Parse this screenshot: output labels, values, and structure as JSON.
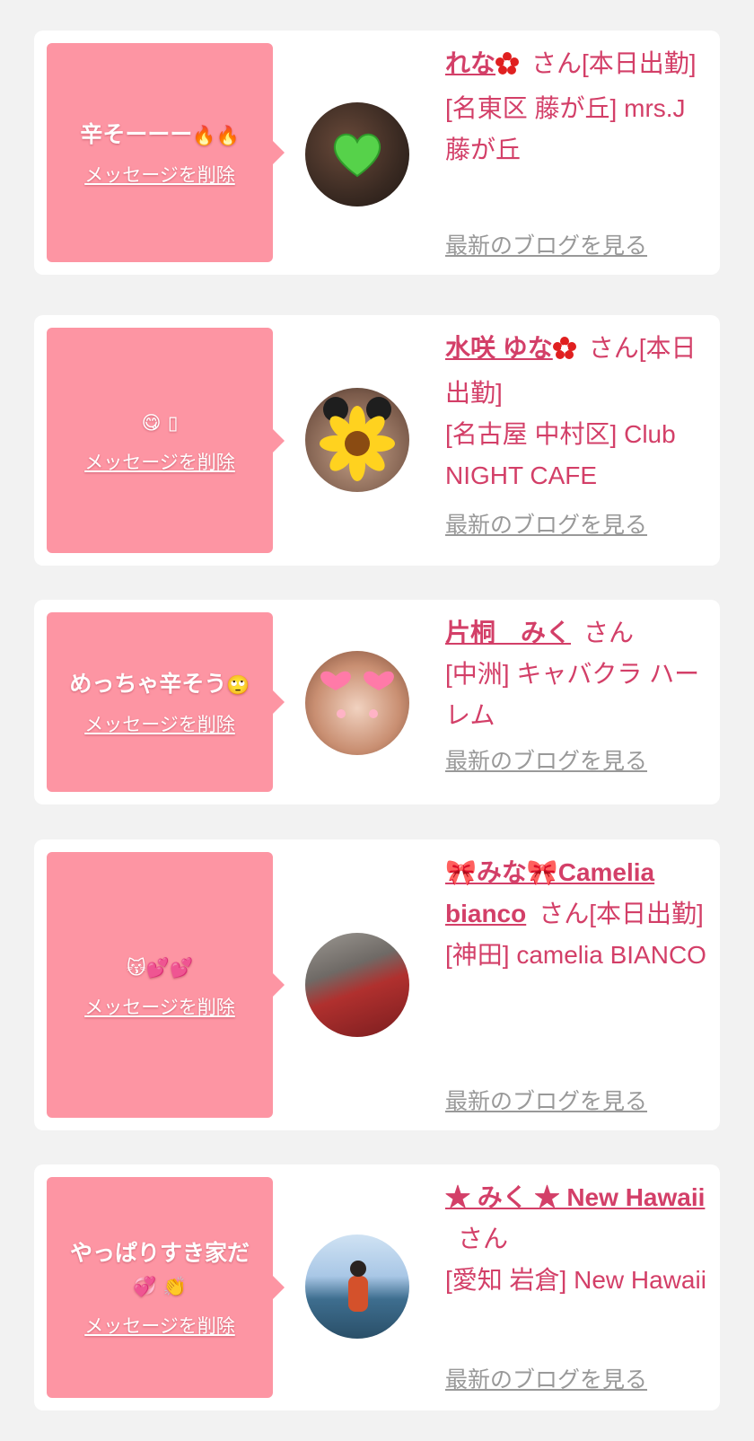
{
  "delete_label": "メッセージを削除",
  "blog_label": "最新のブログを見る",
  "colors": {
    "bubble": "#fd95a3",
    "accent": "#d33f68",
    "muted": "#999999",
    "page_bg": "#f2f2f2"
  },
  "messages": [
    {
      "text": "辛そーーー",
      "emoji": "🔥🔥",
      "name": "れな",
      "name_icon": "red-flower-icon",
      "suffix": "さん[本日出勤]",
      "location": "[名東区 藤が丘] mrs.J藤が丘",
      "avatar_icon": "green-heart-sticker-icon"
    },
    {
      "text": "",
      "emoji": "😋 ▯",
      "name": "水咲 ゆな",
      "name_icon": "red-flower-icon",
      "suffix": "さん[本日出勤]",
      "location": "[名古屋 中村区] Club NIGHT CAFE",
      "avatar_icon": "sunflower-sticker-icon"
    },
    {
      "text": "めっちゃ辛そう",
      "emoji": "🙄",
      "name": "片桐　みく",
      "name_icon": "",
      "suffix": "さん",
      "location": "[中洲] キャバクラ ハーレム",
      "avatar_icon": "heart-ears-filter-icon"
    },
    {
      "text": "",
      "emoji": "😽💕💕",
      "name": "🎀みな🎀Camelia bianco",
      "name_icon": "",
      "suffix": "さん[本日出勤]",
      "location": "[神田] camelia BIANCO",
      "avatar_icon": "photo-icon"
    },
    {
      "text": "やっぱりすき家だ",
      "emoji": "💞 👏",
      "name": "★ みく ★ New Hawaii",
      "name_icon": "",
      "suffix": "さん",
      "location": "[愛知 岩倉] New Hawaii",
      "avatar_icon": "photo-icon"
    }
  ]
}
